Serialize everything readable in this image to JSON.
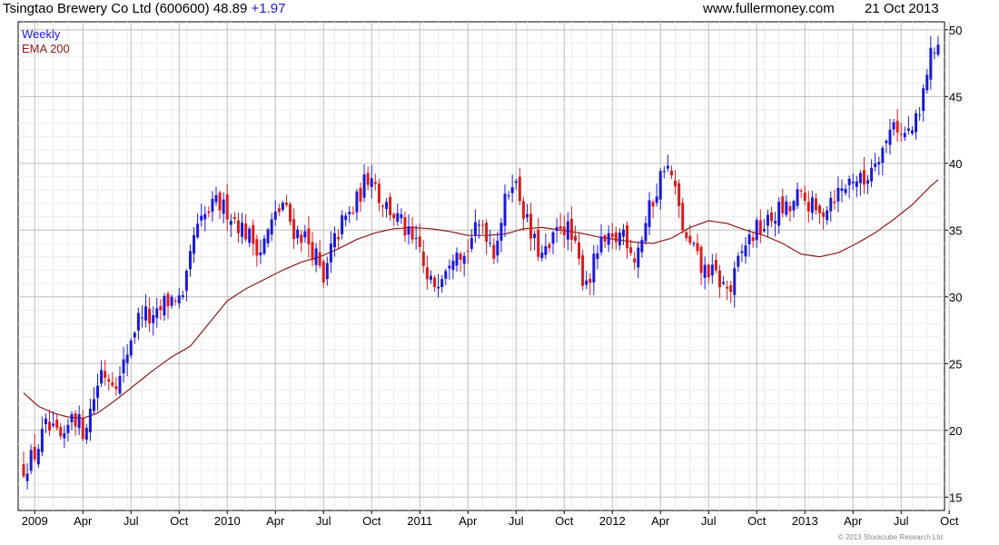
{
  "header": {
    "title": "Tsingtao Brewery Co Ltd (600600)",
    "price": "48.89",
    "change": "+1.97",
    "site": "www.fullermoney.com",
    "date": "21 Oct 2013"
  },
  "footer": {
    "copyright": "© 2013 Stockcube Research Ltd"
  },
  "colors": {
    "up": "#1a1ad8",
    "down": "#dd1a1a",
    "ema": "#8b1a1a",
    "grid": "#d9d9d9",
    "legend_weekly": "#1a1ad8",
    "legend_ema": "#8b1a1a"
  },
  "chart_data": {
    "type": "candlestick",
    "title": "Tsingtao Brewery Co Ltd (600600) 48.89 +1.97",
    "legend": [
      "Weekly",
      "EMA 200"
    ],
    "legend_placement": "top-left",
    "ylim": [
      14,
      50.6
    ],
    "y_ticks": [
      15,
      20,
      25,
      30,
      35,
      40,
      45,
      50
    ],
    "x_ticks": [
      {
        "label": "2009",
        "week": 3
      },
      {
        "label": "Apr",
        "week": 16
      },
      {
        "label": "Jul",
        "week": 29
      },
      {
        "label": "Oct",
        "week": 42
      },
      {
        "label": "2010",
        "week": 55
      },
      {
        "label": "Apr",
        "week": 68
      },
      {
        "label": "Jul",
        "week": 81
      },
      {
        "label": "Oct",
        "week": 94
      },
      {
        "label": "2011",
        "week": 107
      },
      {
        "label": "Apr",
        "week": 120
      },
      {
        "label": "Jul",
        "week": 133
      },
      {
        "label": "Oct",
        "week": 146
      },
      {
        "label": "2012",
        "week": 159
      },
      {
        "label": "Apr",
        "week": 172
      },
      {
        "label": "Jul",
        "week": 185
      },
      {
        "label": "Oct",
        "week": 198
      },
      {
        "label": "2013",
        "week": 211
      },
      {
        "label": "Apr",
        "week": 224
      },
      {
        "label": "Jul",
        "week": 237
      },
      {
        "label": "Oct",
        "week": 250
      }
    ],
    "close_anchors": [
      [
        0,
        17.2
      ],
      [
        3,
        18.2
      ],
      [
        6,
        20.2
      ],
      [
        9,
        19.5
      ],
      [
        11,
        19.0
      ],
      [
        13,
        21.5
      ],
      [
        16,
        20.0
      ],
      [
        18,
        21.5
      ],
      [
        21,
        24.5
      ],
      [
        23,
        24.0
      ],
      [
        26,
        23.8
      ],
      [
        29,
        27.0
      ],
      [
        32,
        29.0
      ],
      [
        35,
        28.0
      ],
      [
        38,
        29.5
      ],
      [
        41,
        30.0
      ],
      [
        43,
        29.5
      ],
      [
        46,
        34.5
      ],
      [
        49,
        36.0
      ],
      [
        52,
        37.0
      ],
      [
        55,
        36.5
      ],
      [
        58,
        35.5
      ],
      [
        61,
        34.5
      ],
      [
        64,
        33.5
      ],
      [
        67,
        35.5
      ],
      [
        70,
        37.0
      ],
      [
        73,
        35.0
      ],
      [
        76,
        34.5
      ],
      [
        79,
        33.0
      ],
      [
        81,
        30.8
      ],
      [
        83,
        33.5
      ],
      [
        86,
        35.5
      ],
      [
        89,
        36.5
      ],
      [
        92,
        38.5
      ],
      [
        94,
        39.5
      ],
      [
        96,
        37.5
      ],
      [
        99,
        36.5
      ],
      [
        102,
        35.5
      ],
      [
        105,
        34.0
      ],
      [
        107,
        33.5
      ],
      [
        109,
        31.0
      ],
      [
        111,
        31.0
      ],
      [
        114,
        32.5
      ],
      [
        117,
        34.0
      ],
      [
        119,
        33.0
      ],
      [
        121,
        34.5
      ],
      [
        124,
        35.5
      ],
      [
        127,
        33.5
      ],
      [
        130,
        37.0
      ],
      [
        132,
        39.0
      ],
      [
        134,
        37.5
      ],
      [
        137,
        34.5
      ],
      [
        140,
        33.0
      ],
      [
        142,
        33.5
      ],
      [
        145,
        35.5
      ],
      [
        147,
        35.0
      ],
      [
        149,
        33.5
      ],
      [
        151,
        31.5
      ],
      [
        153,
        31.5
      ],
      [
        155,
        33.5
      ],
      [
        157,
        34.0
      ],
      [
        159,
        34.0
      ],
      [
        162,
        35.0
      ],
      [
        165,
        33.0
      ],
      [
        167,
        34.5
      ],
      [
        169,
        36.5
      ],
      [
        171,
        38.0
      ],
      [
        173,
        40.0
      ],
      [
        175,
        39.0
      ],
      [
        177,
        36.5
      ],
      [
        179,
        34.0
      ],
      [
        181,
        33.5
      ],
      [
        183,
        32.0
      ],
      [
        185,
        32.0
      ],
      [
        187,
        31.5
      ],
      [
        189,
        30.8
      ],
      [
        191,
        30.5
      ],
      [
        193,
        32.5
      ],
      [
        195,
        34.0
      ],
      [
        198,
        35.0
      ],
      [
        201,
        35.5
      ],
      [
        204,
        36.5
      ],
      [
        207,
        36.5
      ],
      [
        209,
        37.5
      ],
      [
        212,
        37.0
      ],
      [
        215,
        36.0
      ],
      [
        218,
        37.5
      ],
      [
        221,
        38.0
      ],
      [
        224,
        39.0
      ],
      [
        227,
        38.5
      ],
      [
        230,
        40.5
      ],
      [
        233,
        41.5
      ],
      [
        235,
        43.5
      ],
      [
        237,
        42.0
      ],
      [
        240,
        42.5
      ],
      [
        242,
        43.5
      ],
      [
        244,
        47.0
      ],
      [
        246,
        48.9
      ]
    ],
    "ema200_anchors": [
      [
        0,
        22.8
      ],
      [
        4,
        21.8
      ],
      [
        8,
        21.3
      ],
      [
        12,
        21.0
      ],
      [
        16,
        20.9
      ],
      [
        20,
        21.3
      ],
      [
        25,
        22.3
      ],
      [
        30,
        23.4
      ],
      [
        35,
        24.5
      ],
      [
        40,
        25.5
      ],
      [
        45,
        26.3
      ],
      [
        50,
        28.0
      ],
      [
        55,
        29.7
      ],
      [
        60,
        30.6
      ],
      [
        65,
        31.3
      ],
      [
        70,
        32.0
      ],
      [
        75,
        32.6
      ],
      [
        80,
        33.0
      ],
      [
        85,
        33.6
      ],
      [
        90,
        34.3
      ],
      [
        95,
        34.8
      ],
      [
        100,
        35.1
      ],
      [
        105,
        35.2
      ],
      [
        110,
        35.1
      ],
      [
        115,
        34.9
      ],
      [
        120,
        34.6
      ],
      [
        125,
        34.6
      ],
      [
        130,
        34.7
      ],
      [
        135,
        35.1
      ],
      [
        140,
        35.2
      ],
      [
        145,
        35.0
      ],
      [
        150,
        34.8
      ],
      [
        155,
        34.5
      ],
      [
        160,
        34.3
      ],
      [
        165,
        34.1
      ],
      [
        170,
        34.0
      ],
      [
        175,
        34.4
      ],
      [
        180,
        35.2
      ],
      [
        185,
        35.7
      ],
      [
        190,
        35.5
      ],
      [
        195,
        35.0
      ],
      [
        200,
        34.6
      ],
      [
        205,
        34.0
      ],
      [
        210,
        33.2
      ],
      [
        215,
        33.0
      ],
      [
        220,
        33.3
      ],
      [
        225,
        34.0
      ],
      [
        230,
        34.8
      ],
      [
        235,
        35.8
      ],
      [
        240,
        36.9
      ],
      [
        245,
        38.3
      ],
      [
        248,
        39.0
      ]
    ],
    "weeks": 248
  }
}
